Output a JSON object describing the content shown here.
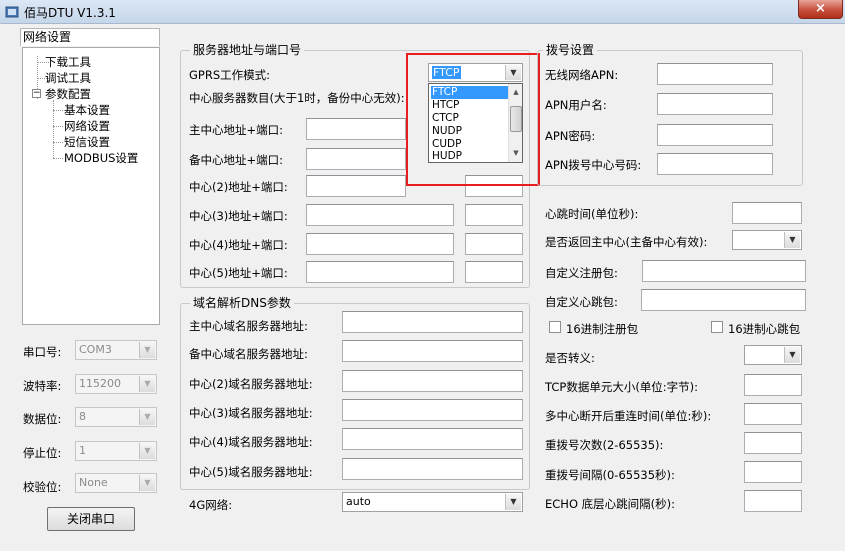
{
  "window": {
    "title": "佰马DTU V1.3.1",
    "close_label": "×"
  },
  "left": {
    "tab_label": "网络设置",
    "tree": [
      {
        "label": "下载工具"
      },
      {
        "label": "调试工具"
      },
      {
        "label": "参数配置"
      },
      {
        "label": "基本设置"
      },
      {
        "label": "网络设置"
      },
      {
        "label": "短信设置"
      },
      {
        "label": "MODBUS设置"
      }
    ],
    "expander": "−",
    "serial": [
      {
        "label": "串口号:",
        "value": "COM3"
      },
      {
        "label": "波特率:",
        "value": "115200"
      },
      {
        "label": "数据位:",
        "value": "8"
      },
      {
        "label": "停止位:",
        "value": "1"
      },
      {
        "label": "校验位:",
        "value": "None"
      }
    ],
    "close_port_button": "关闭串口"
  },
  "server": {
    "group_title": "服务器地址与端口号",
    "gprs_mode_label": "GPRS工作模式:",
    "gprs_mode_value": "FTCP",
    "center_count_label": "中心服务器数目(大于1时，备份中心无效):",
    "rows": [
      {
        "label": "主中心地址+端口:"
      },
      {
        "label": "备中心地址+端口:"
      },
      {
        "label": "中心(2)地址+端口:"
      },
      {
        "label": "中心(3)地址+端口:"
      },
      {
        "label": "中心(4)地址+端口:"
      },
      {
        "label": "中心(5)地址+端口:"
      }
    ],
    "dropdown_options": [
      "FTCP",
      "HTCP",
      "CTCP",
      "NUDP",
      "CUDP",
      "HUDP"
    ],
    "dropdown_selected": "FTCP"
  },
  "dns": {
    "group_title": "域名解析DNS参数",
    "rows": [
      {
        "label": "主中心域名服务器地址:"
      },
      {
        "label": "备中心域名服务器地址:"
      },
      {
        "label": "中心(2)域名服务器地址:"
      },
      {
        "label": "中心(3)域名服务器地址:"
      },
      {
        "label": "中心(4)域名服务器地址:"
      },
      {
        "label": "中心(5)域名服务器地址:"
      }
    ],
    "network_4g_label": "4G网络:",
    "network_4g_value": "auto"
  },
  "dial": {
    "group_title": "拨号设置",
    "rows": [
      {
        "label": "无线网络APN:"
      },
      {
        "label": "APN用户名:"
      },
      {
        "label": "APN密码:"
      },
      {
        "label": "APN拨号中心号码:"
      }
    ]
  },
  "right": {
    "heartbeat_label": "心跳时间(单位秒):",
    "return_main_label": "是否返回主中心(主备中心有效):",
    "custom_register_label": "自定义注册包:",
    "custom_heartbeat_label": "自定义心跳包:",
    "hex_register_label": "16进制注册包",
    "hex_heartbeat_label": "16进制心跳包",
    "escape_label": "是否转义:",
    "tcp_unit_label": "TCP数据单元大小(单位:字节):",
    "reconnect_label": "多中心断开后重连时间(单位:秒):",
    "redial_count_label": "重拨号次数(2-65535):",
    "redial_interval_label": "重拨号间隔(0-65535秒):",
    "echo_label": "ECHO 底层心跳间隔(秒):"
  },
  "icons": {
    "dropdown_arrow": "▼",
    "scroll_up": "▲",
    "scroll_down": "▼"
  },
  "colors": {
    "highlight": "#e81e1e",
    "selection": "#3399ff"
  }
}
